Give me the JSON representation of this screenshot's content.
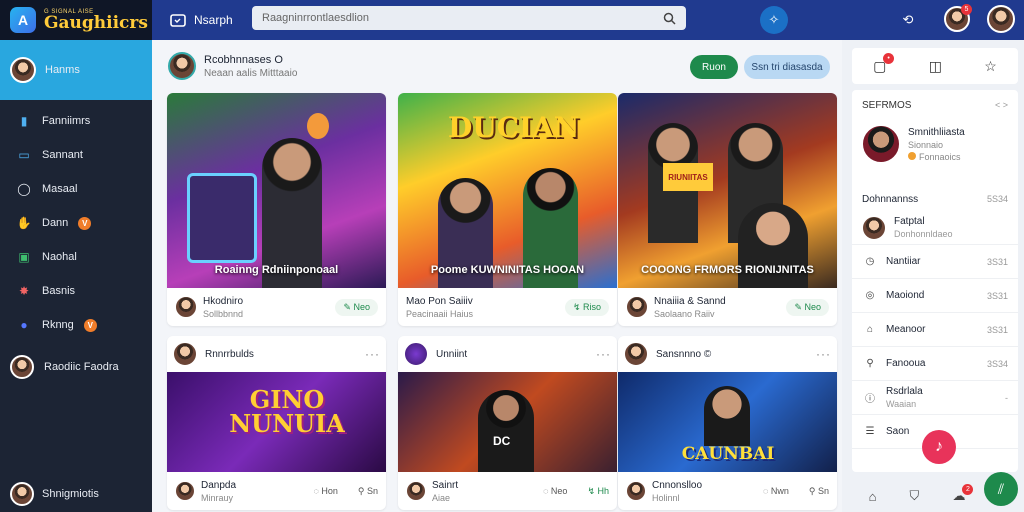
{
  "brand": {
    "tag": "G SIGNAL AISE",
    "name": "Gaughiicrs",
    "logo": "A"
  },
  "sidebar": {
    "active": {
      "label": "Hanms"
    },
    "items": [
      {
        "label": "Fanniimrs",
        "icon": "chart-icon",
        "glyph": "▮",
        "color": "#4fb0f0"
      },
      {
        "label": "Sannant",
        "icon": "screen-icon",
        "glyph": "▭",
        "color": "#4fb0f0"
      },
      {
        "label": "Masaal",
        "icon": "circle-icon",
        "glyph": "◯",
        "color": "#e8ecf3"
      },
      {
        "label": "Dann",
        "icon": "hand-icon",
        "glyph": "✋",
        "color": "#9bb0ff",
        "badge": "V"
      },
      {
        "label": "Naohal",
        "icon": "shield-icon",
        "glyph": "▣",
        "color": "#3fbf6f"
      },
      {
        "label": "Basnis",
        "icon": "fire-icon",
        "glyph": "✸",
        "color": "#f06464"
      },
      {
        "label": "Rknng",
        "icon": "orb-icon",
        "glyph": "●",
        "color": "#5577ff",
        "badge": "V"
      },
      {
        "label": "Raodiic Faodra",
        "icon": "user-avatar",
        "glyph": ""
      }
    ],
    "bottom_user": "Shnigmiotis"
  },
  "topbar": {
    "title": "Nsarph",
    "search_placeholder": "Raagninrrontlaesdlion",
    "notif_count": "5"
  },
  "main": {
    "creator": {
      "name": "Rcobhnnases O",
      "sub": "Neaan aalis  Mitttaaio"
    },
    "follow_label": "Ruon",
    "subscribe_label": "Ssn tri diasasda",
    "top_cards": [
      {
        "title": "Roainng Rdniinponoaal",
        "user": "Hkodniro",
        "sub": "Sollbbnnd",
        "action": "Neo"
      },
      {
        "title": "Poome KUWNINITAS HOOAN",
        "user": "Mao Pon Saiiiv",
        "sub": "Peacinaaii  Haius",
        "action": "Riso",
        "thumb_text": "DUCIAN"
      },
      {
        "title": "COOONG FRMORS RIONIJNITAS",
        "user": "Nnaiiia & Sannd",
        "sub": "Saolaano Raiiv",
        "action": "Neo"
      }
    ],
    "bottom_cards": [
      {
        "head": "Rnnrrbulds",
        "user": "Danpda",
        "sub": "Minrauy",
        "reply": "Hon",
        "action": "Sn",
        "thumb_text": "GINO NUNUIA"
      },
      {
        "head": "Unniint",
        "user": "Sainrt",
        "sub": "Aiae",
        "reply": "Neo",
        "action": "Hh",
        "thumb_text": "DC"
      },
      {
        "head": "Sansnnno ©",
        "user": "Cnnonslloo",
        "sub": "Holinnl",
        "reply": "Nwn",
        "action": "Sn",
        "thumb_text": "CAUNBAI"
      }
    ]
  },
  "right_panel": {
    "section_title": "SEFRMOS",
    "section_arrow": "< >",
    "featured": {
      "name": "Smnithliiasta",
      "sub1": "Sionnaio",
      "sub2": "Fonnaoics"
    },
    "list_title": "Dohnnannss",
    "list_time": "5S34",
    "rows": [
      {
        "name": "Fatptal",
        "sub": "Donhonnldaeo",
        "time": "",
        "icon": "avatar"
      },
      {
        "name": "Nantiiar",
        "time": "3S31",
        "icon": "clock-icon",
        "glyph": "◷"
      },
      {
        "name": "Maoiond",
        "time": "3S31",
        "icon": "target-icon",
        "glyph": "◎"
      },
      {
        "name": "Meanoor",
        "time": "3S31",
        "icon": "home-icon",
        "glyph": "⌂"
      },
      {
        "name": "Fanooua",
        "time": "3S34",
        "icon": "user-icon",
        "glyph": "⚲"
      },
      {
        "name": "Rsdrlala",
        "sub": "Waaian",
        "time": "-",
        "icon": "info-icon",
        "glyph": "ⓘ"
      },
      {
        "name": "Saon",
        "time": "",
        "icon": "list-icon",
        "glyph": "☰"
      }
    ],
    "bottom_notif": "2"
  }
}
